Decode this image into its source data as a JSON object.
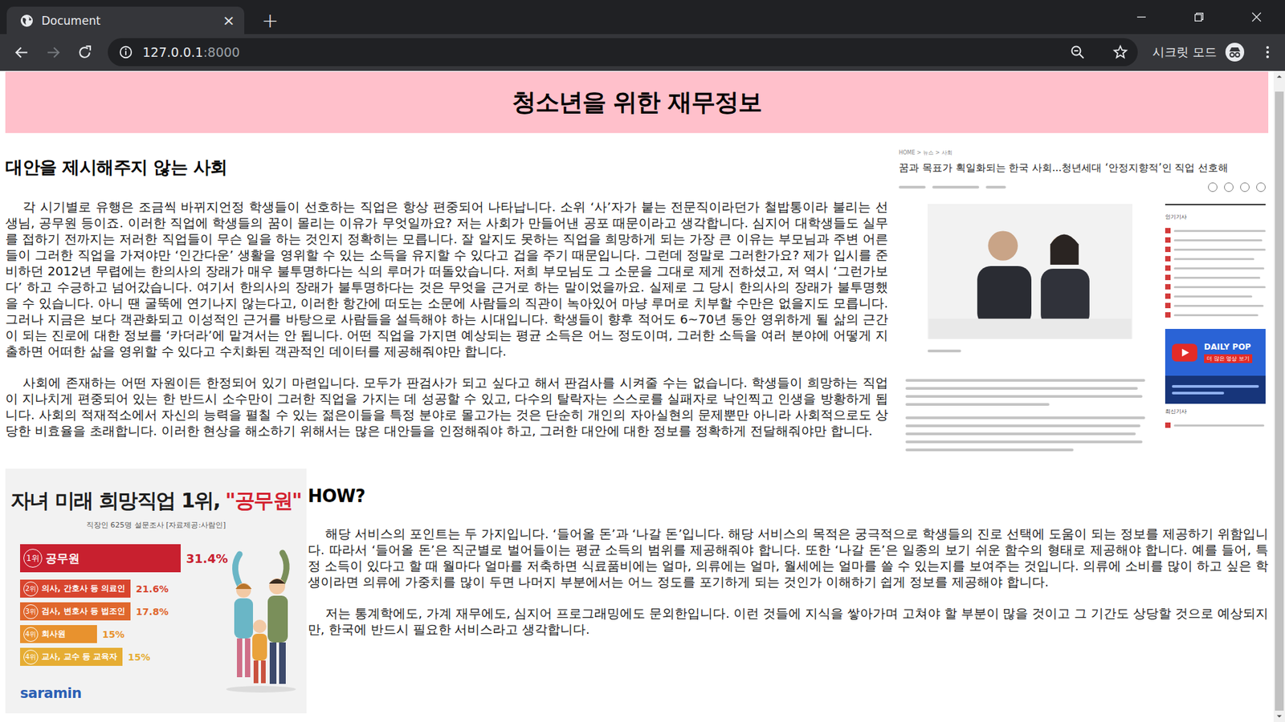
{
  "browser": {
    "tab": {
      "title": "Document",
      "close": "×",
      "selected": true
    },
    "new_tab": "+",
    "url": {
      "host": "127.0.0.1",
      "port": ":8000"
    },
    "incognito_label": "시크릿 모드"
  },
  "page": {
    "header": "청소년을 위한 재무정보",
    "intro": {
      "heading": "대안을 제시해주지 않는 사회",
      "paragraphs": [
        "각 시기별로 유행은 조금씩 바뀌지언정 학생들이 선호하는 직업은 항상 편중되어 나타납니다. 소위 ‘사’자가 붙는 전문직이라던가 철밥통이라 불리는 선생님, 공무원 등이죠. 이러한 직업에 학생들의 꿈이 몰리는 이유가 무엇일까요? 저는 사회가 만들어낸 공포 때문이라고 생각합니다. 심지어 대학생들도 실무를 접하기 전까지는 저러한 직업들이 무슨 일을 하는 것인지 정확히는 모릅니다. 잘 알지도 못하는 직업을 희망하게 되는 가장 큰 이유는 부모님과 주변 어른들이 그러한 직업을 가져야만 ‘인간다운’ 생활을 영위할 수 있는 소득을 유지할 수 있다고 겁을 주기 때문입니다. 그런데 정말로 그러한가요? 제가 입시를 준비하던 2012년 무렵에는 한의사의 장래가 매우 불투명하다는 식의 루머가 떠돌았습니다. 저희 부모님도 그 소문을 그대로 제게 전하셨고, 저 역시 ‘그런가보다’ 하고 수긍하고 넘어갔습니다. 여기서 한의사의 장래가 불투명하다는 것은 무엇을 근거로 하는 말이었을까요. 실제로 그 당시 한의사의 장래가 불투명했을 수 있습니다. 아니 땐 굴뚝에 연기나지 않는다고, 이러한 항간에 떠도는 소문에 사람들의 직관이 녹아있어 마냥 루머로 치부할 수만은 없을지도 모릅니다. 그러나 지금은 보다 객관화되고 이성적인 근거를 바탕으로 사람들을 설득해야 하는 시대입니다. 학생들이 향후 적어도 6~70년 동안 영위하게 될 삶의 근간이 되는 진로에 대한 정보를 ‘카더라’에 맡겨서는 안 됩니다. 어떤 직업을 가지면 예상되는 평균 소득은 어느 정도이며, 그러한 소득을 여러 분야에 어떻게 지출하면 어떠한 삶을 영위할 수 있다고 수치화된 객관적인 데이터를 제공해줘야만 합니다.",
        "사회에 존재하는 어떤 자원이든 한정되어 있기 마련입니다. 모두가 판검사가 되고 싶다고 해서 판검사를 시켜줄 수는 없습니다. 학생들이 희망하는 직업이 지나치게 편중되어 있는 한 반드시 소수만이 그러한 직업을 가지는 데 성공할 수 있고, 다수의 탈락자는 스스로를 실패자로 낙인찍고 인생을 방황하게 됩니다. 사회의 적재적소에서 자신의 능력을 펼칠 수 있는 젊은이들을 특정 분야로 몰고가는 것은 단순히 개인의 자아실현의 문제뿐만 아니라 사회적으로도 상당한 비효율을 초래합니다. 이러한 현상을 해소하기 위해서는 많은 대안들을 인정해줘야 하고, 그러한 대안에 대한 정보를 정확하게 전달해줘야만 합니다."
      ]
    },
    "how": {
      "heading": "HOW?",
      "paragraphs": [
        "해당 서비스의 포인트는 두 가지입니다. ‘들어올 돈’과 ‘나갈 돈’입니다. 해당 서비스의 목적은 궁극적으로 학생들의 진로 선택에 도움이 되는 정보를 제공하기 위함입니다. 따라서 ‘들어올 돈’은 직군별로 벌어들이는 평균 소득의 범위를 제공해줘야 합니다. 또한 ‘나갈 돈’은 일종의 보기 쉬운 함수의 형태로 제공해야 합니다. 예를 들어, 특정 소득이 있다고 할 때 월마다 얼마를 저축하면 식료품비에는 얼마, 의류에는 얼마, 월세에는 얼마를 쓸 수 있는지를 보여주는 것입니다. 의류에 소비를 많이 하고 싶은 학생이라면 의류에 가중치를 많이 두면 나머지 부분에서는 어느 정도를 포기하게 되는 것인가 이해하기 쉽게 정보를 제공해야 합니다.",
        "저는 통계학에도, 가계 재무에도, 심지어 프로그래밍에도 문외한입니다. 이런 것들에 지식을 쌓아가며 고쳐야 할 부분이 많을 것이고 그 기간도 상당할 것으로 예상되지만, 한국에 반드시 필요한 서비스라고 생각합니다."
      ]
    }
  },
  "news_image": {
    "breadcrumb": "HOME > 뉴스 > 사회",
    "title": "꿈과 목표가 획일화되는 한국 사회...청년세대 ‘안정지향적’인 직업 선호해",
    "popular_heading": "인기기사",
    "latest_heading": "최신기사",
    "ad": {
      "title": "DAILY POP",
      "cta": "더 많은 영상 보기"
    }
  },
  "infographic": {
    "title": "자녀 미래 희망직업 1위,",
    "title_highlight": "\"공무원\"",
    "subtitle": "직장인 625명 설문조사 [자료제공:사람인]",
    "logo": "saramin",
    "items": [
      {
        "rank": "1위",
        "label": "공무원",
        "value": 31.4,
        "value_label": "31.4%",
        "color": "#c8202f"
      },
      {
        "rank": "2위",
        "label": "의사, 간호사 등 의료인",
        "value": 21.6,
        "value_label": "21.6%",
        "color": "#d8452e"
      },
      {
        "rank": "3위",
        "label": "검사, 변호사 등 법조인",
        "value": 17.8,
        "value_label": "17.8%",
        "color": "#e0672c"
      },
      {
        "rank": "4위",
        "label": "회사원",
        "value": 15,
        "value_label": "15%",
        "color": "#e8922e"
      },
      {
        "rank": "4위",
        "label": "교사, 교수 등 교육자",
        "value": 15,
        "value_label": "15%",
        "color": "#e6ad33"
      }
    ]
  }
}
